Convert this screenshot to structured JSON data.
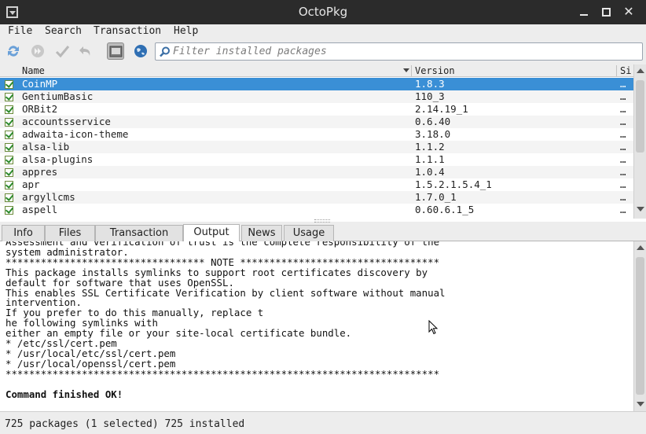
{
  "window": {
    "title": "OctoPkg"
  },
  "menu": {
    "items": [
      "File",
      "Search",
      "Transaction",
      "Help"
    ]
  },
  "toolbar": {
    "icons": [
      "sync-database-icon",
      "system-upgrade-icon",
      "commit-icon",
      "rollback-icon",
      "terminal-icon",
      "aur-globe-icon"
    ],
    "filter_placeholder": "Filter installed packages"
  },
  "table": {
    "columns": [
      "Name",
      "Version",
      "Si:"
    ],
    "rows": [
      {
        "name": "CoinMP",
        "version": "1.8.3",
        "size": "…",
        "selected": true
      },
      {
        "name": "GentiumBasic",
        "version": "110_3",
        "size": "…"
      },
      {
        "name": "ORBit2",
        "version": "2.14.19_1",
        "size": "…"
      },
      {
        "name": "accountsservice",
        "version": "0.6.40",
        "size": "…"
      },
      {
        "name": "adwaita-icon-theme",
        "version": "3.18.0",
        "size": "…"
      },
      {
        "name": "alsa-lib",
        "version": "1.1.2",
        "size": "…"
      },
      {
        "name": "alsa-plugins",
        "version": "1.1.1",
        "size": "…"
      },
      {
        "name": "appres",
        "version": "1.0.4",
        "size": "…"
      },
      {
        "name": "apr",
        "version": "1.5.2.1.5.4_1",
        "size": "…"
      },
      {
        "name": "argyllcms",
        "version": "1.7.0_1",
        "size": "…"
      },
      {
        "name": "aspell",
        "version": "0.60.6.1_5",
        "size": "…"
      }
    ]
  },
  "tabs": [
    "Info",
    "Files",
    "Transaction",
    "Output",
    "News",
    "Usage"
  ],
  "active_tab": "Output",
  "output": {
    "lines": [
      "Assessment and verification of trust is the complete responsibility of the",
      "system administrator.",
      "********************************** NOTE **********************************",
      "This package installs symlinks to support root certificates discovery by",
      "default for software that uses OpenSSL.",
      "This enables SSL Certificate Verification by client software without manual",
      "intervention.",
      "If you prefer to do this manually, replace t",
      "he following symlinks with",
      "either an empty file or your site-local certificate bundle.",
      "* /etc/ssl/cert.pem",
      "* /usr/local/etc/ssl/cert.pem",
      "* /usr/local/openssl/cert.pem",
      "**************************************************************************",
      ""
    ],
    "final_line": "Command finished OK!"
  },
  "status": {
    "text": "725 packages (1 selected)  725 installed"
  }
}
